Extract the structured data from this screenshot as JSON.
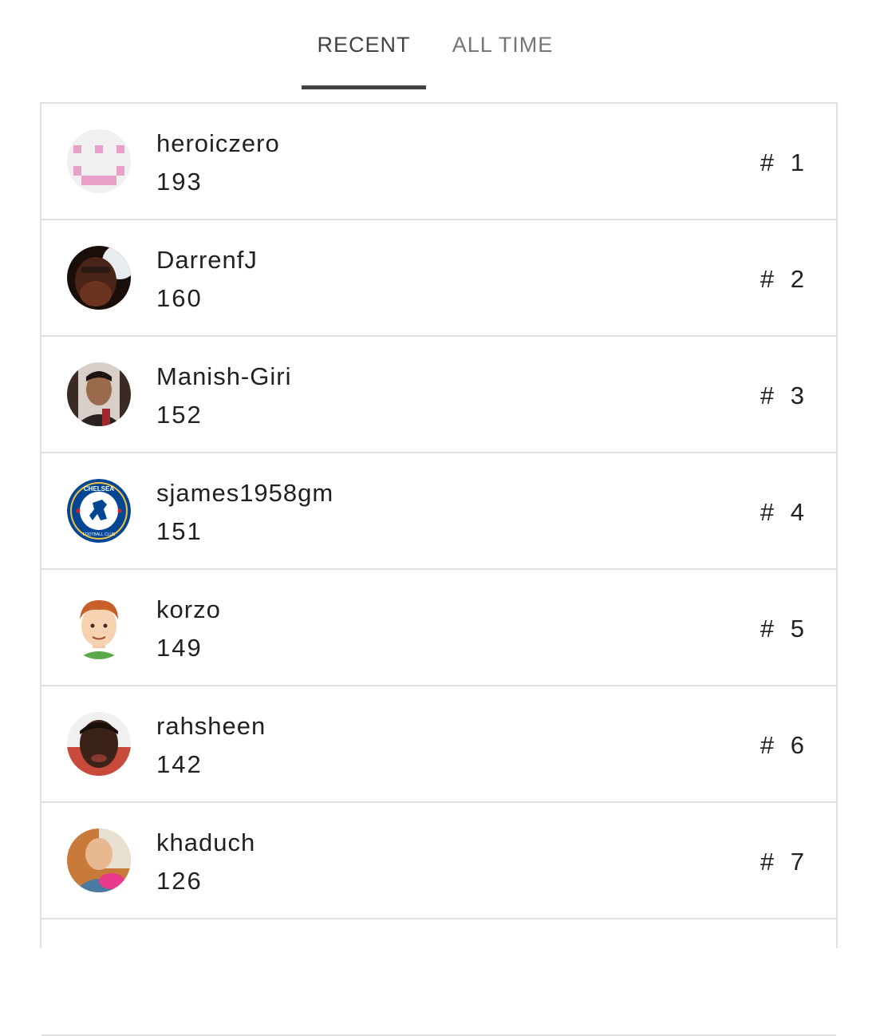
{
  "tabs": [
    {
      "label": "RECENT",
      "active": true
    },
    {
      "label": "ALL TIME",
      "active": false
    }
  ],
  "colors": {
    "active_tab": "#424242",
    "inactive_tab": "#757575",
    "border": "#e0e0e0"
  },
  "leaderboard": [
    {
      "name": "heroiczero",
      "score": "193",
      "rank": "# 1",
      "avatar": "pink-pixel-smiley-avatar"
    },
    {
      "name": "DarrenfJ",
      "score": "160",
      "rank": "# 2",
      "avatar": "bearded-man-photo-avatar"
    },
    {
      "name": "Manish-Giri",
      "score": "152",
      "rank": "# 3",
      "avatar": "young-man-photo-avatar"
    },
    {
      "name": "sjames1958gm",
      "score": "151",
      "rank": "# 4",
      "avatar": "chelsea-crest-avatar",
      "avatar_text": "CHELSEA FOOTBALL CLUB"
    },
    {
      "name": "korzo",
      "score": "149",
      "rank": "# 5",
      "avatar": "cartoon-man-avatar"
    },
    {
      "name": "rahsheen",
      "score": "142",
      "rank": "# 6",
      "avatar": "man-selfie-photo-avatar"
    },
    {
      "name": "khaduch",
      "score": "126",
      "rank": "# 7",
      "avatar": "man-holding-object-photo-avatar"
    }
  ]
}
